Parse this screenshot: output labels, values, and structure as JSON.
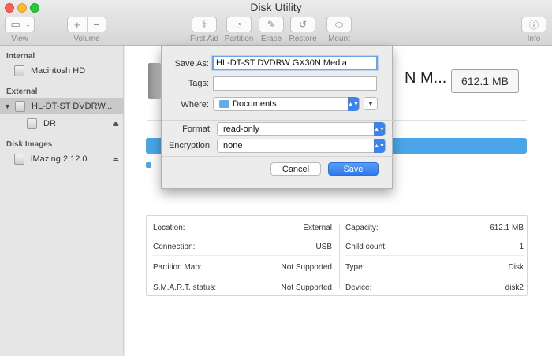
{
  "window": {
    "title": "Disk Utility"
  },
  "toolbar": {
    "view_label": "View",
    "volume_label": "Volume",
    "volume_add": "+",
    "volume_remove": "−",
    "first_aid_label": "First Aid",
    "partition_label": "Partition",
    "erase_label": "Erase",
    "restore_label": "Restore",
    "mount_label": "Mount",
    "info_label": "Info"
  },
  "sidebar": {
    "sections": [
      {
        "header": "Internal",
        "items": [
          {
            "label": "Macintosh HD"
          }
        ]
      },
      {
        "header": "External",
        "items": [
          {
            "label": "HL-DT-ST DVDRW...",
            "selected": true
          },
          {
            "label": "DR"
          }
        ]
      },
      {
        "header": "Disk Images",
        "items": [
          {
            "label": "iMazing 2.12.0"
          }
        ]
      }
    ]
  },
  "main": {
    "disk_name_fragment": "N M...",
    "capacity_display": "612.1 MB",
    "usage_fill_fraction": 1.0,
    "usage_color": "#4aa6e8",
    "info": {
      "left": [
        {
          "label": "Location:",
          "value": "External"
        },
        {
          "label": "Connection:",
          "value": "USB"
        },
        {
          "label": "Partition Map:",
          "value": "Not Supported"
        },
        {
          "label": "S.M.A.R.T. status:",
          "value": "Not Supported"
        }
      ],
      "right": [
        {
          "label": "Capacity:",
          "value": "612.1 MB"
        },
        {
          "label": "Child count:",
          "value": "1"
        },
        {
          "label": "Type:",
          "value": "Disk"
        },
        {
          "label": "Device:",
          "value": "disk2"
        }
      ]
    }
  },
  "sheet": {
    "save_as_label": "Save As:",
    "save_as_value": "HL-DT-ST DVDRW GX30N Media",
    "tags_label": "Tags:",
    "tags_value": "",
    "where_label": "Where:",
    "where_value": "Documents",
    "format_label": "Format:",
    "format_value": "read-only",
    "encryption_label": "Encryption:",
    "encryption_value": "none",
    "cancel_label": "Cancel",
    "save_label": "Save"
  }
}
